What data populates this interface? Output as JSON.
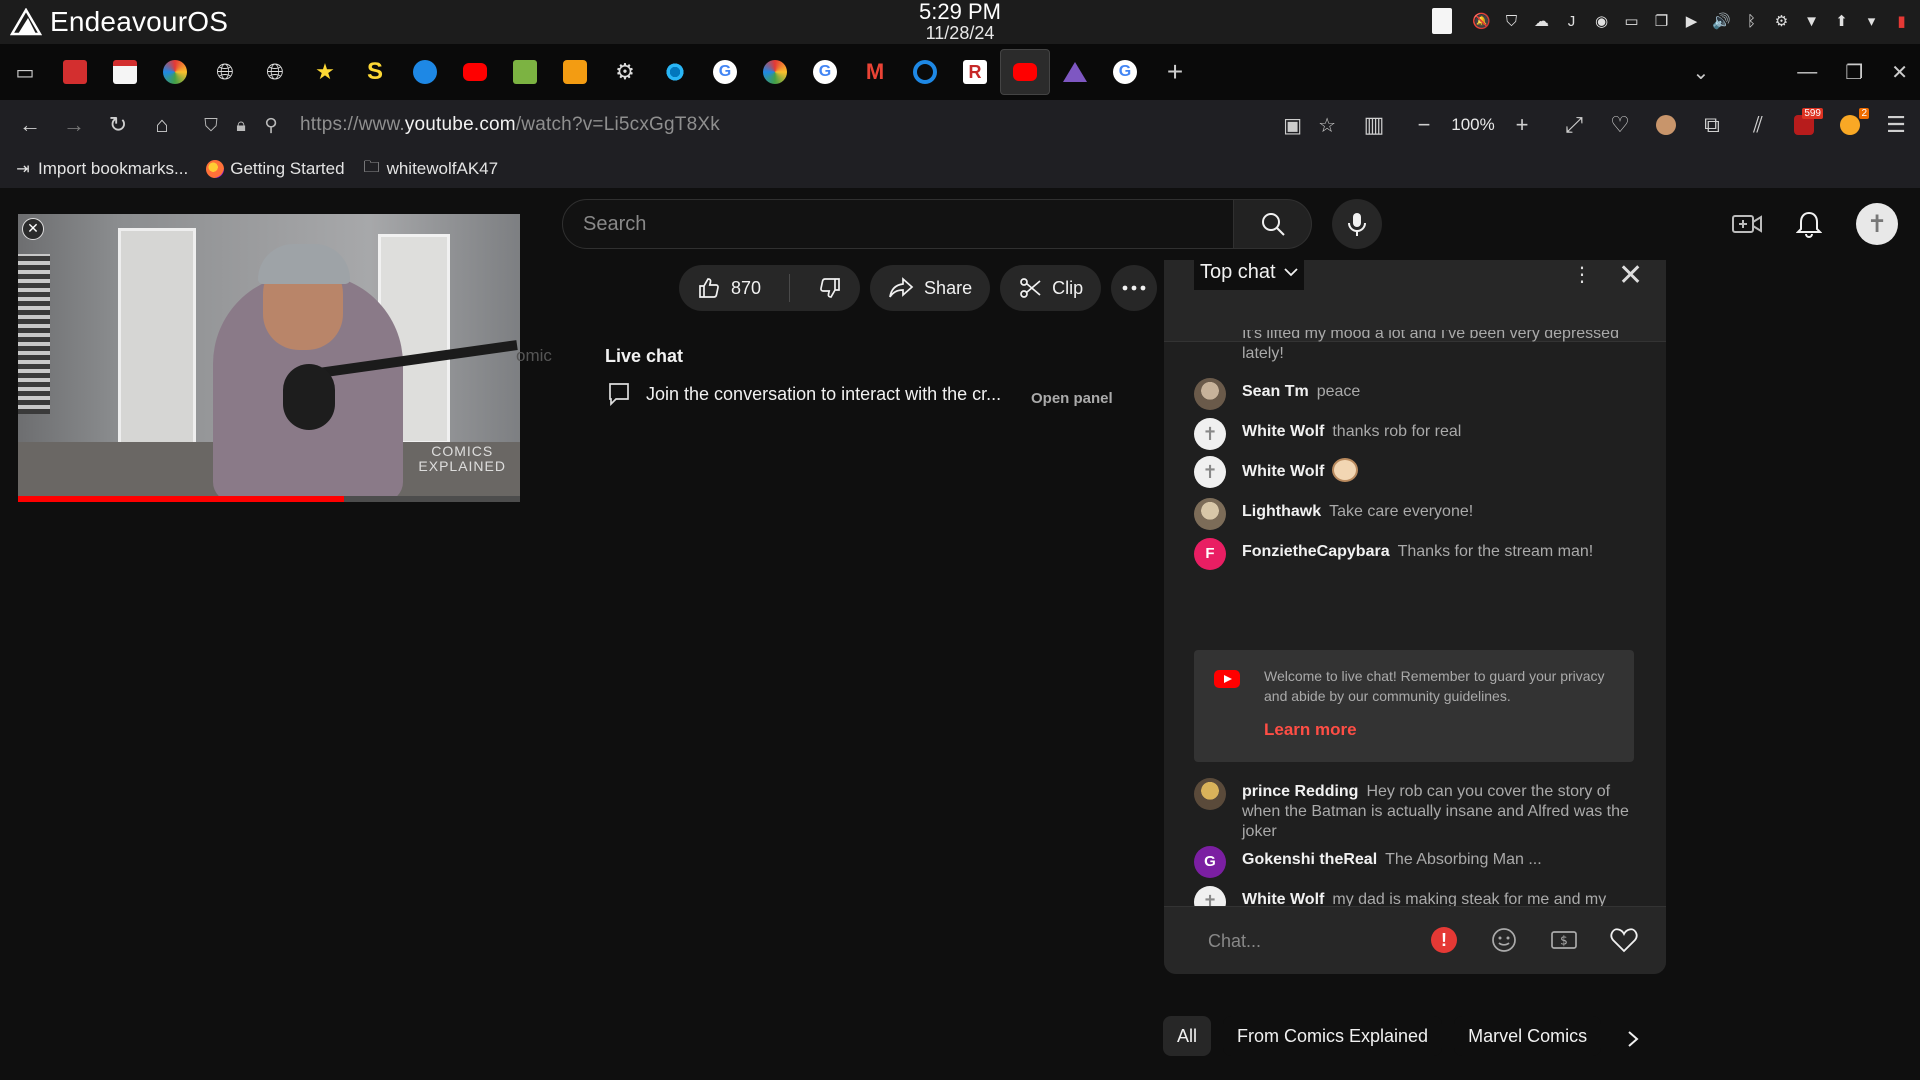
{
  "system": {
    "brand": "EndeavourOS",
    "time": "5:29 PM",
    "date": "11/28/24"
  },
  "browser": {
    "url_prefix": "https://www.",
    "url_domain": "youtube.com",
    "url_path": "/watch?v=Li5cxGgT8Xk",
    "zoom": "100%",
    "badge_count": "599",
    "badge_small": "2",
    "bookmarks": [
      {
        "label": "Import bookmarks...",
        "icon": "import-icon"
      },
      {
        "label": "Getting Started",
        "icon": "firefox-icon"
      },
      {
        "label": "whitewolfAK47",
        "icon": "folder-icon"
      }
    ]
  },
  "youtube": {
    "search_placeholder": "Search",
    "like_count": "870",
    "share_label": "Share",
    "clip_label": "Clip",
    "ghost_text": "omic",
    "watermark_line1": "COMICS",
    "watermark_line2": "EXPLAINED",
    "progress_fraction": 0.65,
    "live_chat": {
      "title": "Live chat",
      "message": "Join the conversation to interact with the cr...",
      "open_panel": "Open panel"
    }
  },
  "chat": {
    "mode": "Top chat",
    "faded_text": "It's lifted my mood a lot and I've been very depressed lately!",
    "messages": [
      {
        "name": "Sean Tm",
        "text": "peace",
        "avatar": "photo"
      },
      {
        "name": "White Wolf",
        "text": "thanks rob for real",
        "avatar": "wolf"
      },
      {
        "name": "White Wolf",
        "text": "",
        "avatar": "wolf",
        "emoji": "dog-emoji"
      },
      {
        "name": "Lighthawk",
        "text": "Take care everyone!",
        "avatar": "light"
      },
      {
        "name": "FonzietheCapybara",
        "text": "Thanks for the stream man!",
        "avatar": "F"
      },
      {
        "name": "prince Redding",
        "text": "Hey rob can you cover the story of when the Batman is actually insane and Alfred was the joker",
        "avatar": "prince"
      },
      {
        "name": "Gokenshi theReal",
        "text": "The Absorbing Man ...",
        "avatar": "G"
      },
      {
        "name": "White Wolf",
        "text": "my dad is making steak for me and my dog instead of turkey cuz he didn't leave it out in time but i am happier with steak tbh im getting mine medium rare...",
        "avatar": "wolf"
      }
    ],
    "welcome_text": "Welcome to live chat! Remember to guard your privacy and abide by our community guidelines.",
    "learn_more": "Learn more",
    "input_placeholder": "Chat..."
  },
  "chips": {
    "all": "All",
    "from_channel": "From Comics Explained",
    "marvel": "Marvel Comics"
  },
  "colors": {
    "accent_red": "#ff0000",
    "learn_more_red": "#ff4e45",
    "fonzie_avatar": "#e91e63",
    "gokenshi_avatar": "#7b1fa2"
  }
}
